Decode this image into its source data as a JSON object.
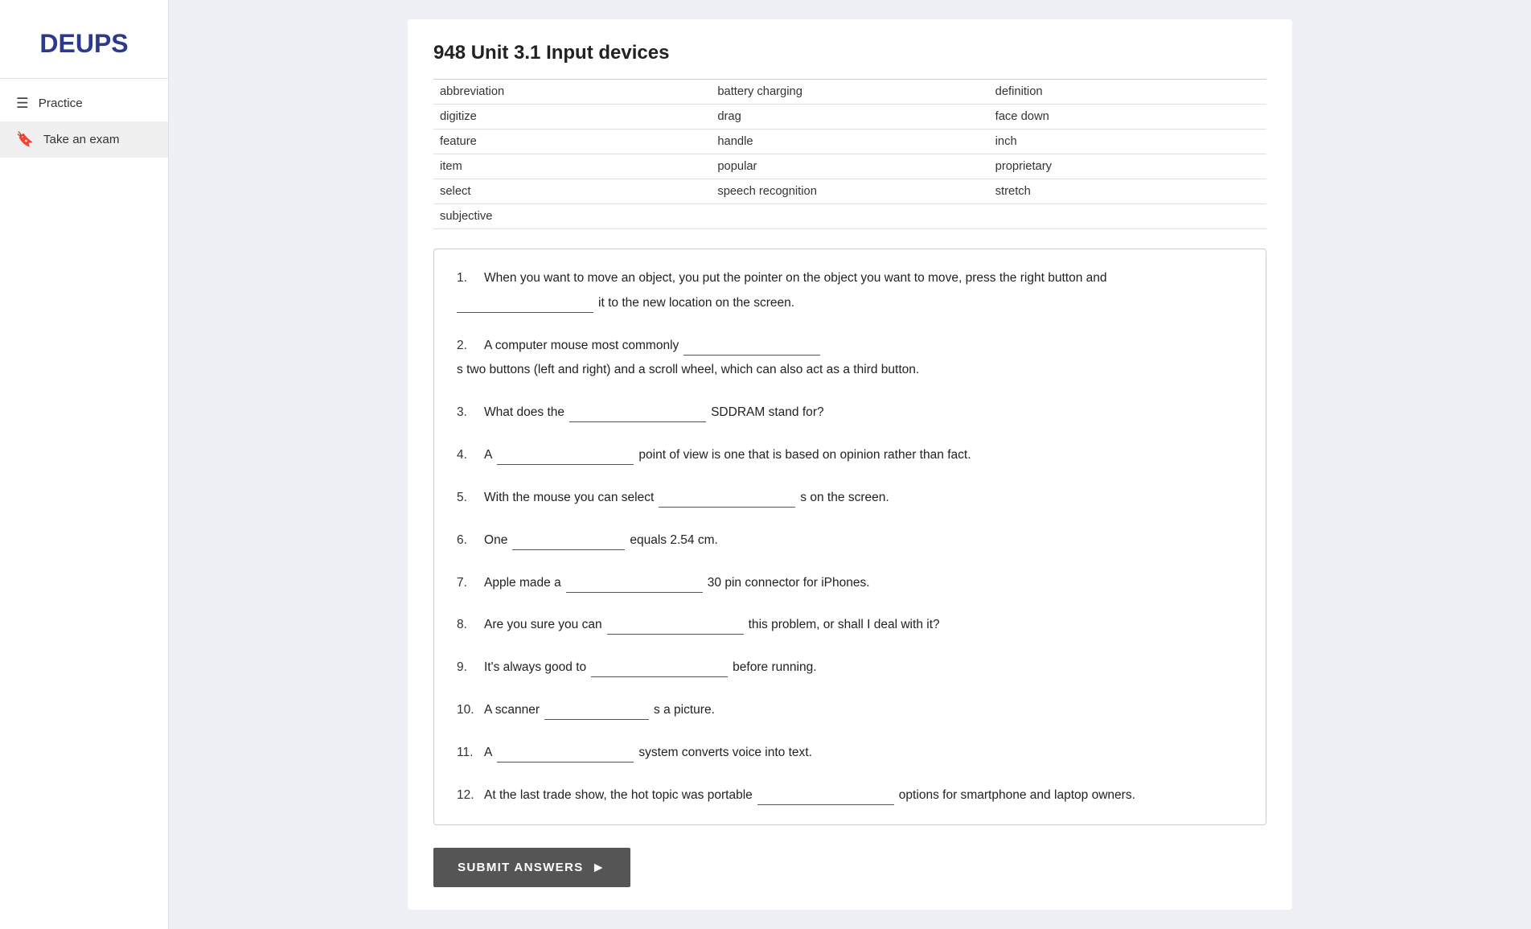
{
  "logo": "DEUPS",
  "sidebar": {
    "items": [
      {
        "id": "practice",
        "label": "Practice",
        "icon": "☰"
      },
      {
        "id": "take-an-exam",
        "label": "Take an exam",
        "icon": "🔖"
      }
    ]
  },
  "exam": {
    "title": "948 Unit 3.1 Input devices",
    "word_bank": [
      "abbreviation",
      "battery charging",
      "definition",
      "digitize",
      "drag",
      "face down",
      "feature",
      "handle",
      "inch",
      "item",
      "popular",
      "proprietary",
      "select",
      "speech recognition",
      "stretch",
      "subjective",
      "",
      ""
    ],
    "word_bank_cols": 3,
    "questions": [
      {
        "number": "1.",
        "parts": [
          "When you want to move an object, you put the pointer on the object you want to move, press the right button and",
          "blank",
          "it to the new location on the screen."
        ]
      },
      {
        "number": "2.",
        "parts": [
          "A computer mouse most commonly",
          "blank",
          "s two buttons (left and right) and a scroll wheel, which can also act as a third button."
        ]
      },
      {
        "number": "3.",
        "parts": [
          "What does the",
          "blank",
          "SDDRAM stand for?"
        ]
      },
      {
        "number": "4.",
        "parts": [
          "A",
          "blank",
          "point of view is one that is based on opinion rather than fact."
        ]
      },
      {
        "number": "5.",
        "parts": [
          "With the mouse you can select",
          "blank",
          "s on the screen."
        ]
      },
      {
        "number": "6.",
        "parts": [
          "One",
          "blank",
          "equals 2.54 cm."
        ]
      },
      {
        "number": "7.",
        "parts": [
          "Apple made a",
          "blank",
          "30 pin connector for iPhones."
        ]
      },
      {
        "number": "8.",
        "parts": [
          "Are you sure you can",
          "blank",
          "this problem, or shall I deal with it?"
        ]
      },
      {
        "number": "9.",
        "parts": [
          "It's always good to",
          "blank",
          "before running."
        ]
      },
      {
        "number": "10.",
        "parts": [
          "A scanner",
          "blank",
          "s a picture."
        ]
      },
      {
        "number": "11.",
        "parts": [
          "A",
          "blank",
          "system converts voice into text."
        ]
      },
      {
        "number": "12.",
        "parts": [
          "At the last trade show, the hot topic was portable",
          "blank",
          "options for smartphone and laptop owners."
        ]
      }
    ],
    "submit_label": "SUBMIT ANSWERS"
  }
}
